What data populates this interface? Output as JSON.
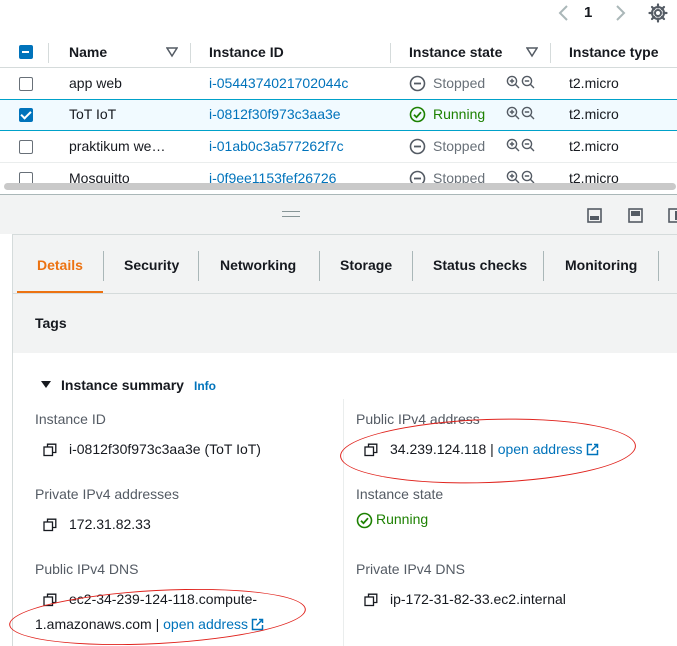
{
  "pagination": {
    "current_page": "1"
  },
  "table": {
    "columns": [
      "Name",
      "Instance ID",
      "Instance state",
      "Instance type"
    ],
    "rows": [
      {
        "name": "app web",
        "id": "i-0544374021702044c",
        "state": "Stopped",
        "type": "t2.micro",
        "selected": false
      },
      {
        "name": "ToT IoT",
        "id": "i-0812f30f973c3aa3e",
        "state": "Running",
        "type": "t2.micro",
        "selected": true
      },
      {
        "name": "praktikum we…",
        "id": "i-01ab0c3a577262f7c",
        "state": "Stopped",
        "type": "t2.micro",
        "selected": false
      },
      {
        "name": "Mosquitto",
        "id": "i-0f9ee1153fef26726",
        "state": "Stopped",
        "type": "t2.micro",
        "selected": false
      }
    ]
  },
  "tabs": [
    "Details",
    "Security",
    "Networking",
    "Storage",
    "Status checks",
    "Monitoring",
    "Tags"
  ],
  "summary": {
    "title": "Instance summary",
    "info": "Info",
    "instance_id_label": "Instance ID",
    "instance_id_value": "i-0812f30f973c3aa3e (ToT IoT)",
    "private_ipv4_label": "Private IPv4 addresses",
    "private_ipv4_value": "172.31.82.33",
    "public_dns_label": "Public IPv4 DNS",
    "public_dns_line1": "ec2-34-239-124-118.compute-",
    "public_dns_line2": "1.amazonaws.com",
    "public_ipv4_label": "Public IPv4 address",
    "public_ipv4_value": "34.239.124.118",
    "open_address": "open address",
    "separator": "|",
    "state_label": "Instance state",
    "state_value": "Running",
    "private_dns_label": "Private IPv4 DNS",
    "private_dns_value": "ip-172-31-82-33.ec2.internal"
  },
  "colors": {
    "link": "#0073bb",
    "running": "#1d8102",
    "stopped": "#687078",
    "active_tab": "#ec7211",
    "annotation": "#e0231d"
  },
  "icons": [
    "chevron-left-icon",
    "chevron-right-icon",
    "gear-icon",
    "sort-icon",
    "stopped-icon",
    "running-icon",
    "zoom-in-icon",
    "zoom-out-icon",
    "copy-icon",
    "external-link-icon",
    "caret-down-icon",
    "drag-handle-icon",
    "pane-bottom-icon",
    "pane-split-icon",
    "pane-side-icon"
  ]
}
